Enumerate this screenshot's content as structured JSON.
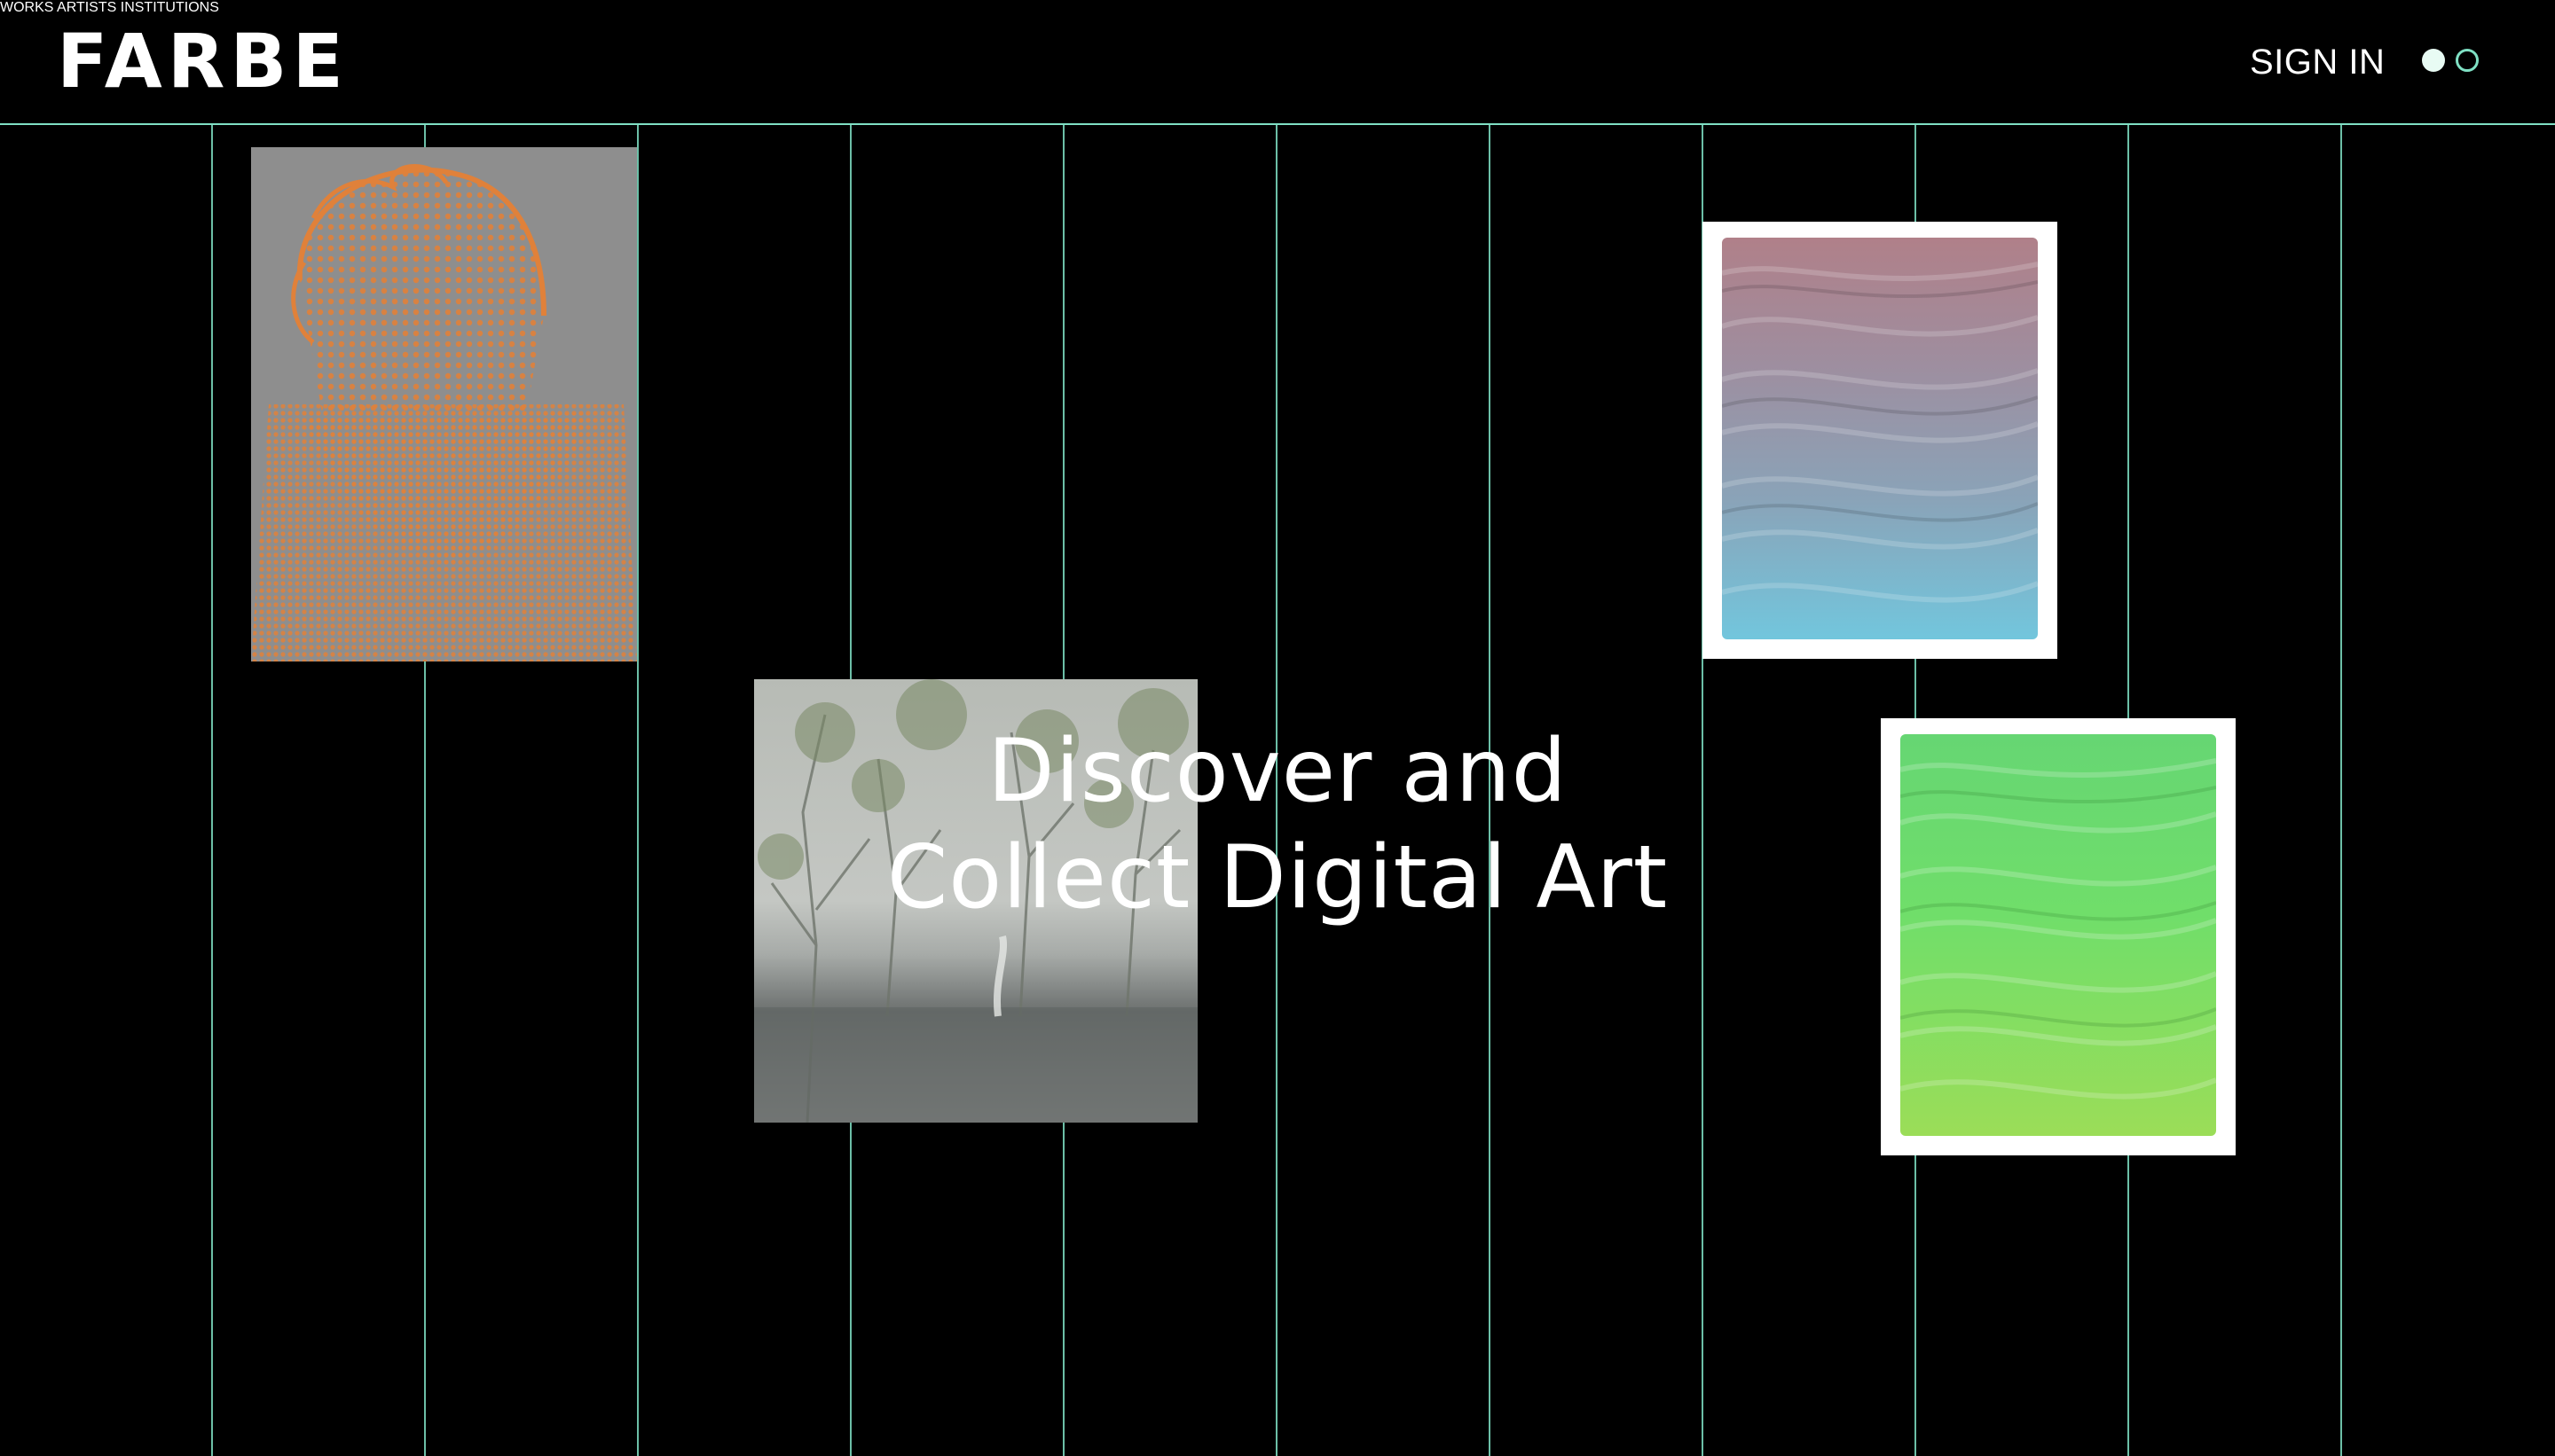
{
  "brand": {
    "logo_text": "FARBE"
  },
  "nav": {
    "items": [
      {
        "label": "WORKS"
      },
      {
        "label": "ARTISTS"
      },
      {
        "label": "INSTITUTIONS"
      }
    ],
    "sign_in_label": "SIGN IN"
  },
  "theme_toggle": {
    "options": [
      "filled-dot",
      "outline-dot"
    ]
  },
  "hero": {
    "line1": "Discover and",
    "line2": "Collect Digital Art"
  },
  "colors": {
    "background": "#000000",
    "grid_line": "#7fe0c4",
    "text": "#ffffff",
    "portrait_orange": "#e0813a",
    "portrait_gray": "#8e8e8e"
  },
  "artworks": [
    {
      "name": "orange-halftone-portrait",
      "depicts": "orange halftone figure on gray"
    },
    {
      "name": "misty-forest-lake",
      "depicts": "foggy trees over water"
    },
    {
      "name": "pink-blue-impasto",
      "depicts": "textured paint pink to blue gradient"
    },
    {
      "name": "green-impasto",
      "depicts": "textured paint green gradient"
    }
  ]
}
